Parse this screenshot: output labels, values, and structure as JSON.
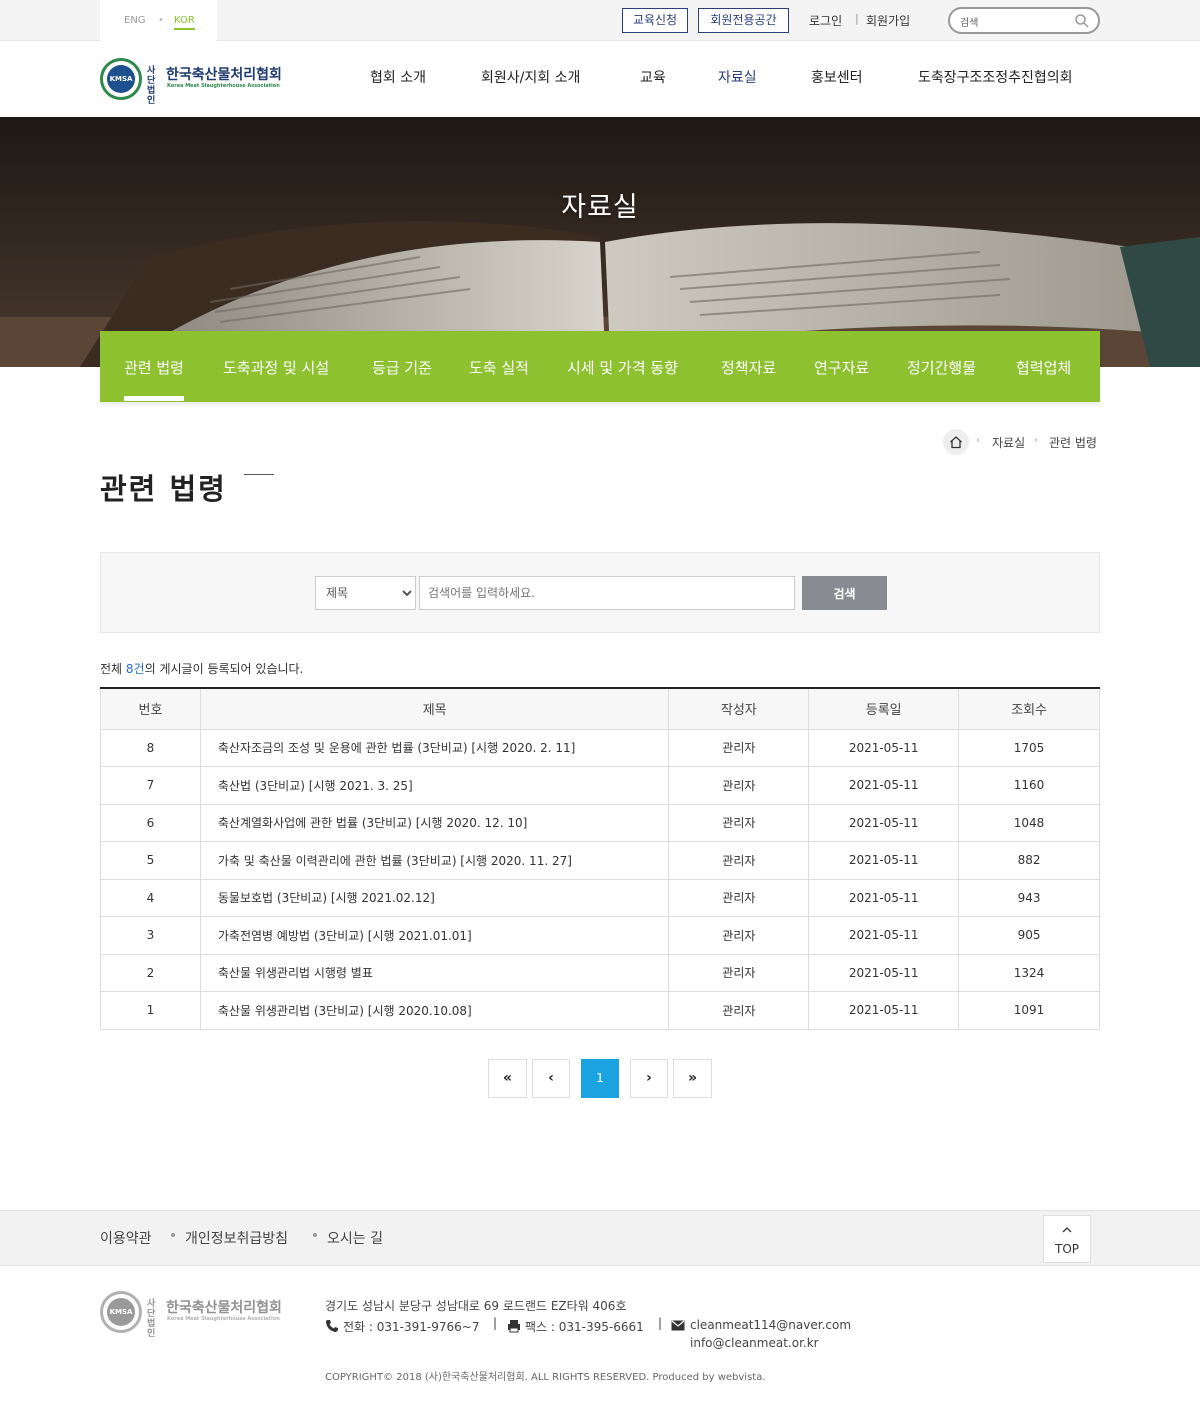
{
  "topbar": {
    "lang_eng": "ENG",
    "lang_kor": "KOR",
    "edu_apply": "교육신청",
    "member_space": "회원전용공간",
    "login": "로그인",
    "sep": "|",
    "join": "회원가입",
    "search_value": "검색",
    "accent": "#8dc12f"
  },
  "logo": {
    "circle_text": "KMSA",
    "tag": "사단법인",
    "name_kor": "한국축산물처리협회",
    "name_en": "Korea Meat Slaughterhouse Association"
  },
  "gnb": [
    {
      "label": "협회 소개",
      "active": false
    },
    {
      "label": "회원사/지회 소개",
      "active": false
    },
    {
      "label": "교육",
      "active": false
    },
    {
      "label": "자료실",
      "active": true
    },
    {
      "label": "홍보센터",
      "active": false
    },
    {
      "label": "도축장구조조정추진협의회",
      "active": false
    }
  ],
  "banner": {
    "title": "자료실"
  },
  "subnav": [
    {
      "label": "관련 법령",
      "active": true
    },
    {
      "label": "도축과정 및 시설",
      "active": false
    },
    {
      "label": "등급 기준",
      "active": false
    },
    {
      "label": "도축 실적",
      "active": false
    },
    {
      "label": "시세 및 가격 동향",
      "active": false
    },
    {
      "label": "정책자료",
      "active": false
    },
    {
      "label": "연구자료",
      "active": false
    },
    {
      "label": "정기간행물",
      "active": false
    },
    {
      "label": "협력업체",
      "active": false
    }
  ],
  "breadcrumb": {
    "level1": "자료실",
    "level2": "관련 법령"
  },
  "page_title": "관련 법령",
  "search": {
    "select_value": "제목",
    "placeholder": "검색어를 입력하세요.",
    "button": "검색"
  },
  "count": {
    "prefix": "전체 ",
    "num": "8건",
    "suffix": "의 게시글이 등록되어 있습니다."
  },
  "table": {
    "headers": [
      "번호",
      "제목",
      "작성자",
      "등록일",
      "조회수"
    ],
    "rows": [
      {
        "no": "8",
        "title": "축산자조금의 조성 및 운용에 관한 법률 (3단비교) [시행 2020. 2. 11]",
        "author": "관리자",
        "date": "2021-05-11",
        "views": "1705"
      },
      {
        "no": "7",
        "title": "축산법 (3단비교) [시행 2021. 3. 25]",
        "author": "관리자",
        "date": "2021-05-11",
        "views": "1160"
      },
      {
        "no": "6",
        "title": "축산계열화사업에 관한 법률 (3단비교) [시행 2020. 12. 10]",
        "author": "관리자",
        "date": "2021-05-11",
        "views": "1048"
      },
      {
        "no": "5",
        "title": "가축 및 축산물 이력관리에 관한 법률 (3단비교) [시행 2020. 11. 27]",
        "author": "관리자",
        "date": "2021-05-11",
        "views": "882"
      },
      {
        "no": "4",
        "title": "동물보호법 (3단비교) [시행 2021.02.12]",
        "author": "관리자",
        "date": "2021-05-11",
        "views": "943"
      },
      {
        "no": "3",
        "title": "가축전염병 예방법 (3단비교) [시행 2021.01.01]",
        "author": "관리자",
        "date": "2021-05-11",
        "views": "905"
      },
      {
        "no": "2",
        "title": "축산물 위생관리법 시행령 별표",
        "author": "관리자",
        "date": "2021-05-11",
        "views": "1324"
      },
      {
        "no": "1",
        "title": "축산물 위생관리법 (3단비교) [시행 2020.10.08]",
        "author": "관리자",
        "date": "2021-05-11",
        "views": "1091"
      }
    ]
  },
  "pagination": {
    "first": "«",
    "prev": "‹",
    "current": "1",
    "next": "›",
    "last": "»"
  },
  "footer": {
    "links": [
      "이용약관",
      "개인정보취급방침",
      "오시는 길"
    ],
    "top": "TOP",
    "address": "경기도 성남시 분당구 성남대로 69 로드랜드 EZ타워 406호",
    "phone": "전화 : 031-391-9766~7",
    "fax": "팩스 : 031-395-6661",
    "email1": "cleanmeat114@naver.com",
    "email2": "info@cleanmeat.or.kr",
    "sep": "|",
    "copyright": "COPYRIGHT© 2018 (사)한국축산물처리협회. ALL RIGHTS RESERVED. Produced by webvista."
  }
}
